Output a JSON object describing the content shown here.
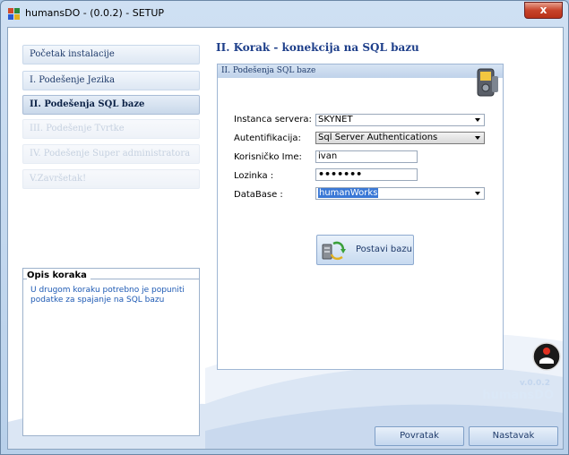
{
  "window": {
    "title": "humansDO - (0.0.2) - SETUP",
    "close_glyph": "x"
  },
  "steps": [
    {
      "label": "Početak instalacije",
      "state": "normal"
    },
    {
      "label": "I. Podešenje Jezika",
      "state": "normal"
    },
    {
      "label": "II. Podešenja SQL baze",
      "state": "active"
    },
    {
      "label": "III. Podešenje Tvrtke",
      "state": "disabled"
    },
    {
      "label": "IV. Podešenje Super administratora",
      "state": "disabled"
    },
    {
      "label": "V.Završetak!",
      "state": "disabled"
    }
  ],
  "description": {
    "title": "Opis koraka",
    "text": "U drugom koraku potrebno je popuniti podatke za spajanje na SQL bazu"
  },
  "main": {
    "heading": "II. Korak - konekcija na SQL bazu",
    "panel_title": "II. Podešenja SQL baze"
  },
  "form": {
    "server_label": "Instanca servera:",
    "server_value": "SKYNET",
    "auth_label": "Autentifikacija:",
    "auth_value": "Sql Server Authentications",
    "user_label": "Korisničko Ime:",
    "user_value": "ivan",
    "password_label": "Lozinka :",
    "password_value": "•••••••",
    "database_label": "DataBase :",
    "database_value": "humanWorks",
    "apply_label": "Postavi bazu"
  },
  "brand": {
    "version": "v.0.0.2",
    "name": "humansDO"
  },
  "nav": {
    "back_label": "Povratak",
    "next_label": "Nastavak"
  },
  "colors": {
    "heading": "#1e3f8a",
    "accent": "#3a78d6",
    "description_text": "#1e5ab4"
  }
}
